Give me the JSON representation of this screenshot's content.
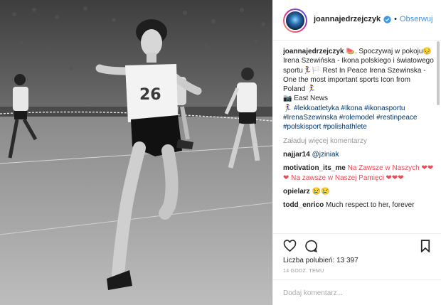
{
  "post": {
    "photo_alt": "",
    "runner_number": "26"
  },
  "header": {
    "username": "joannajedrzejczyk",
    "separator": "•",
    "follow_label": "Obserwuj"
  },
  "caption": {
    "username": "joannajedrzejczyk",
    "text_1": "🍉. Spoczywaj w pokoju😔 Irena Szewińska - Ikona polskiego i światowego sportu🏃‍♀️🏳️ Rest In Peace Irena Szewinska - One the most important sports Icon from Poland 🏃‍♀️",
    "text_2": "📷 East News",
    "hashtags_prefix": "🏃‍♀️",
    "hashtags": "#lekkoatletyka #Ikona #ikonasportu #IrenaSzewinska #rolemodel #restinpeace #polskisport #polishathlete"
  },
  "load_more": "Załaduj więcej komentarzy",
  "comments": [
    {
      "user": "najjar14",
      "mention": "@jziniak",
      "text": ""
    },
    {
      "user": "motivation_its_me",
      "mention": "",
      "text": "Na Zawsze w Naszych ❤❤❤ Na zawsze w Naszej Pamięci ❤❤❤"
    },
    {
      "user": "opielarz",
      "mention": "",
      "text": "😢😢"
    },
    {
      "user": "todd_enrico",
      "mention": "",
      "text": "Much respect to her, forever"
    }
  ],
  "likes": {
    "label": "Liczba polubień:",
    "count": "13 397"
  },
  "time_ago": "14 GODZ. TEMU",
  "add_comment_placeholder": "Dodaj komentarz...",
  "colors": {
    "link": "#3897f0",
    "hashtag": "#003569",
    "heart": "#ed4956",
    "muted": "#999999"
  },
  "icons": [
    "heart-icon",
    "comment-icon",
    "bookmark-icon",
    "verified-icon"
  ]
}
